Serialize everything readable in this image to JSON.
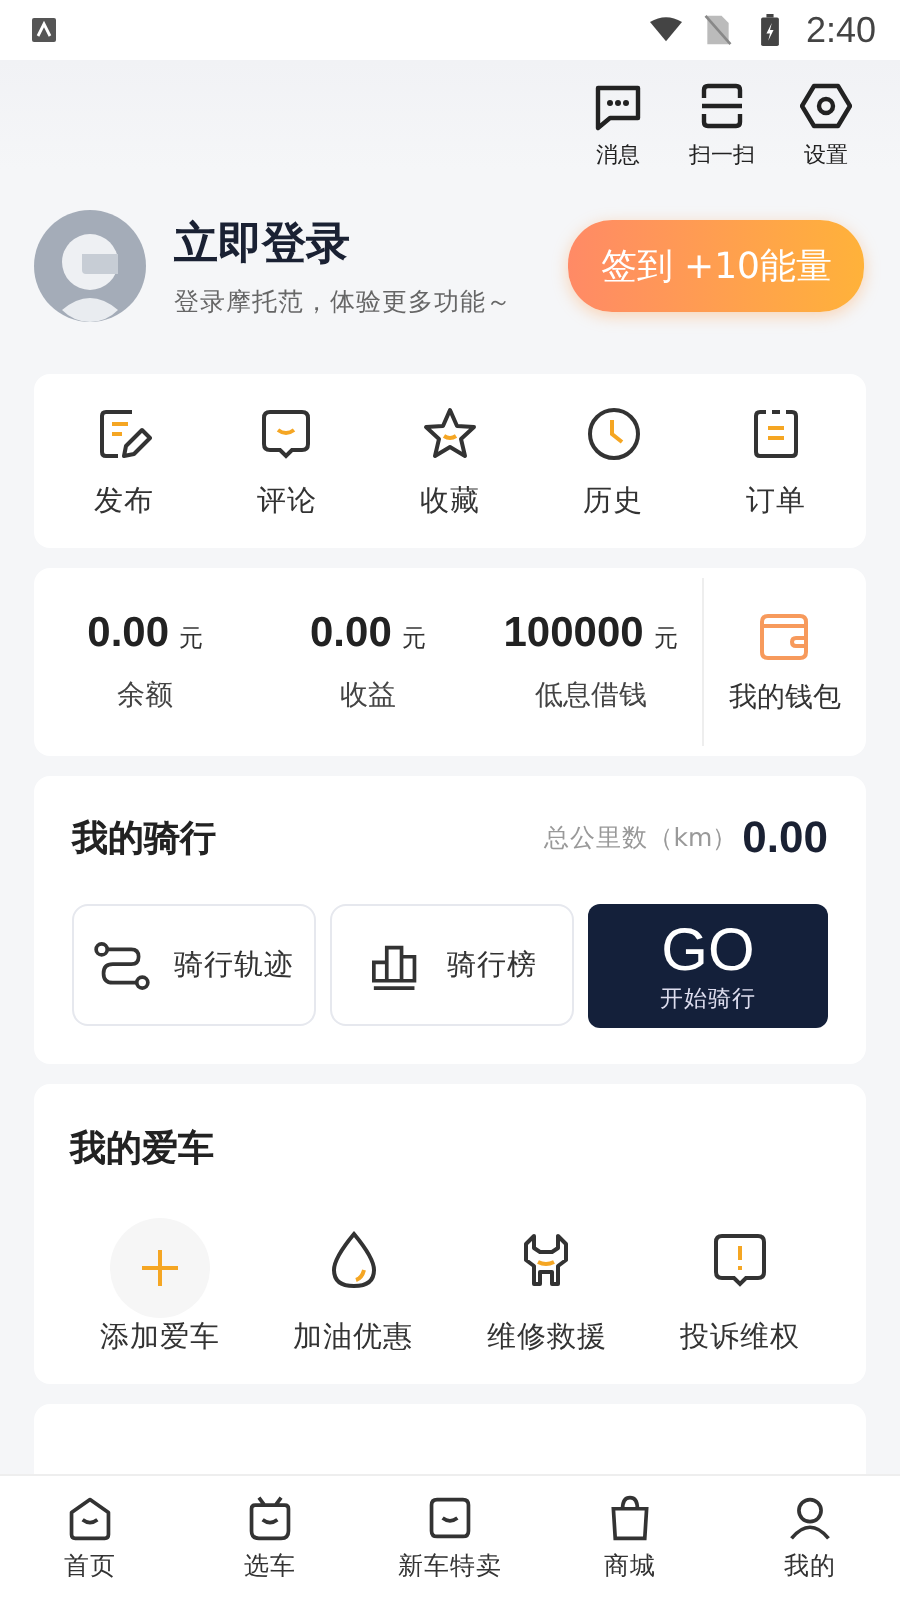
{
  "status_bar": {
    "time": "2:40"
  },
  "top_actions": [
    {
      "label": "消息",
      "kind": "message"
    },
    {
      "label": "扫一扫",
      "kind": "scan"
    },
    {
      "label": "设置",
      "kind": "settings"
    }
  ],
  "profile": {
    "name": "立即登录",
    "subtitle": "登录摩托范，体验更多功能～",
    "checkin": "签到 +10能量"
  },
  "shortcuts": [
    {
      "label": "发布",
      "kind": "edit"
    },
    {
      "label": "评论",
      "kind": "comment"
    },
    {
      "label": "收藏",
      "kind": "star"
    },
    {
      "label": "历史",
      "kind": "clock"
    },
    {
      "label": "订单",
      "kind": "order"
    }
  ],
  "wallet": {
    "stats": [
      {
        "value": "0.00",
        "unit": "元",
        "label": "余额"
      },
      {
        "value": "0.00",
        "unit": "元",
        "label": "收益"
      },
      {
        "value": "100000",
        "unit": "元",
        "label": "低息借钱"
      }
    ],
    "wallet_label": "我的钱包"
  },
  "riding": {
    "title": "我的骑行",
    "distance_label": "总公里数（km）",
    "distance": "0.00",
    "buttons": [
      {
        "label": "骑行轨迹",
        "kind": "route"
      },
      {
        "label": "骑行榜",
        "kind": "rank"
      }
    ],
    "go": {
      "label": "GO",
      "sub": "开始骑行"
    }
  },
  "my_car": {
    "title": "我的爱车",
    "items": [
      {
        "label": "添加爱车",
        "kind": "add"
      },
      {
        "label": "加油优惠",
        "kind": "fuel"
      },
      {
        "label": "维修救援",
        "kind": "repair"
      },
      {
        "label": "投诉维权",
        "kind": "complaint"
      }
    ]
  },
  "bottom_nav": [
    {
      "label": "首页",
      "kind": "home"
    },
    {
      "label": "选车",
      "kind": "car"
    },
    {
      "label": "新车特卖",
      "kind": "new"
    },
    {
      "label": "商城",
      "kind": "mall"
    },
    {
      "label": "我的",
      "kind": "me"
    }
  ]
}
